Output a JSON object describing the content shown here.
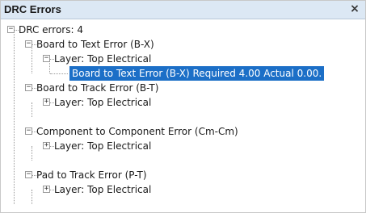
{
  "window": {
    "title": "DRC Errors",
    "close_glyph": "×"
  },
  "tree": {
    "root": "DRC errors: 4",
    "groups": [
      {
        "label": "Board to Text Error (B-X)",
        "layer": "Layer: Top Electrical",
        "detail": "Board to Text Error (B-X) Required 4.00 Actual 0.00."
      },
      {
        "label": "Board to Track Error (B-T)",
        "layer": "Layer: Top Electrical"
      },
      {
        "label": "Component to Component Error (Cm-Cm)",
        "layer": "Layer: Top Electrical"
      },
      {
        "label": "Pad to Track Error (P-T)",
        "layer": "Layer: Top Electrical"
      }
    ],
    "expanded_glyph": "−",
    "collapsed_glyph": "+"
  }
}
